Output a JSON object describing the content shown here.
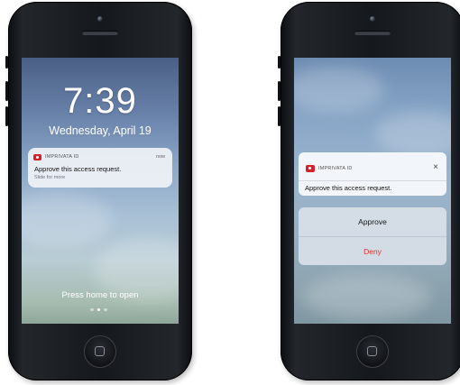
{
  "lock_screen": {
    "time": "7:39",
    "date": "Wednesday, April 19",
    "notification": {
      "app_name": "IMPRIVATA ID",
      "timestamp": "now",
      "message": "Approve this access request.",
      "hint": "Slide for more"
    },
    "footer_text": "Press home to open",
    "page_indicator": {
      "total": 3,
      "active_index": 1
    }
  },
  "expanded_notification": {
    "app_name": "IMPRIVATA ID",
    "close_icon": "×",
    "message": "Approve this access request.",
    "approve_label": "Approve",
    "deny_label": "Deny"
  },
  "colors": {
    "app_icon": "#d8202a",
    "deny": "#e0342f"
  }
}
